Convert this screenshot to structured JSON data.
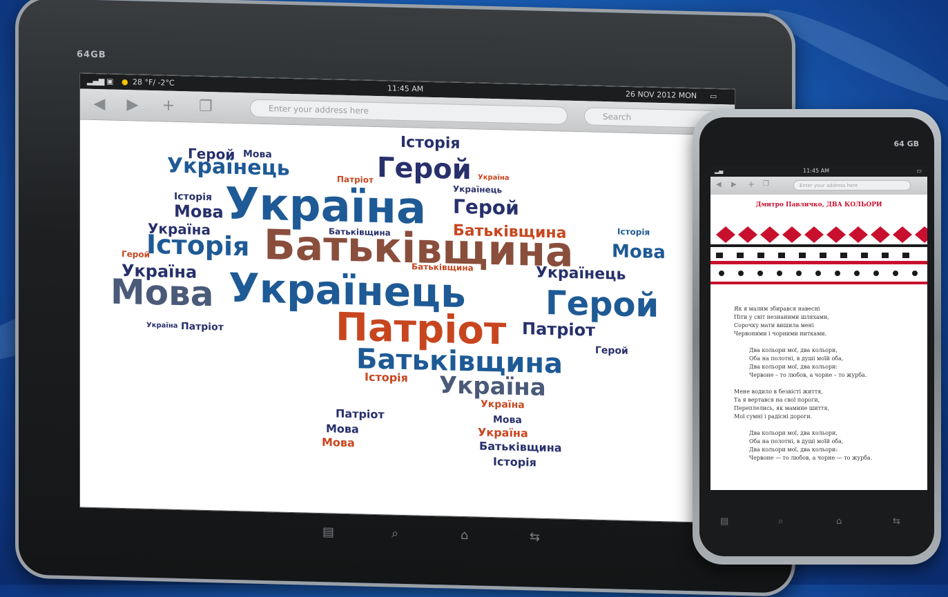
{
  "tablet": {
    "brand": "64GB",
    "status": {
      "weather": "28 °F/ -2°C",
      "time": "11:45 AM",
      "date": "26 NOV 2012 MON"
    },
    "browser": {
      "address_placeholder": "Enter your address here",
      "search_placeholder": "Search"
    },
    "words": {
      "batkivshchyna": "Батьківщина",
      "ukrainets": "Українець",
      "ukraina": "Україна",
      "patriot": "Патріот",
      "heroi": "Герой",
      "istoriia": "Історія",
      "mova": "Мова"
    }
  },
  "phone": {
    "brand": "64 GB",
    "status": {
      "time": "11:45 AM"
    },
    "browser": {
      "address_placeholder": "Enter your address here"
    },
    "poem_title": "Дмитро Павличко, ДВА КОЛЬОРИ",
    "poem_stanzas": [
      [
        "Як я малим збирався навесні",
        "Піти у світ незнаними шляхами,",
        "Сорочку мати вишила мені",
        "Червоними і чорними нитками."
      ],
      [
        "Два кольори мої, два кольори,",
        "Оба на полотні, в душі моїй оба,",
        "Два кольори мої, два кольори:",
        "Червоне – то любов, а чорне – то журба."
      ],
      [
        "Мене водило в безвісті життя,",
        "Та я вертався на свої пороги,",
        "Переплелись, як мамине шиття,",
        "Мої сумні і радісні дороги."
      ],
      [
        "Два кольори мої, два кольори,",
        "Оба на полотні, в душі моїй оба,",
        "Два кольори мої, два кольори:",
        "Червоне — то любов, а чорне — то журба."
      ]
    ]
  },
  "colors": {
    "navy": "#27306b",
    "blue": "#1e5a95",
    "brown": "#8a4e3c",
    "red": "#c8461f",
    "slate": "#4a5a78"
  }
}
